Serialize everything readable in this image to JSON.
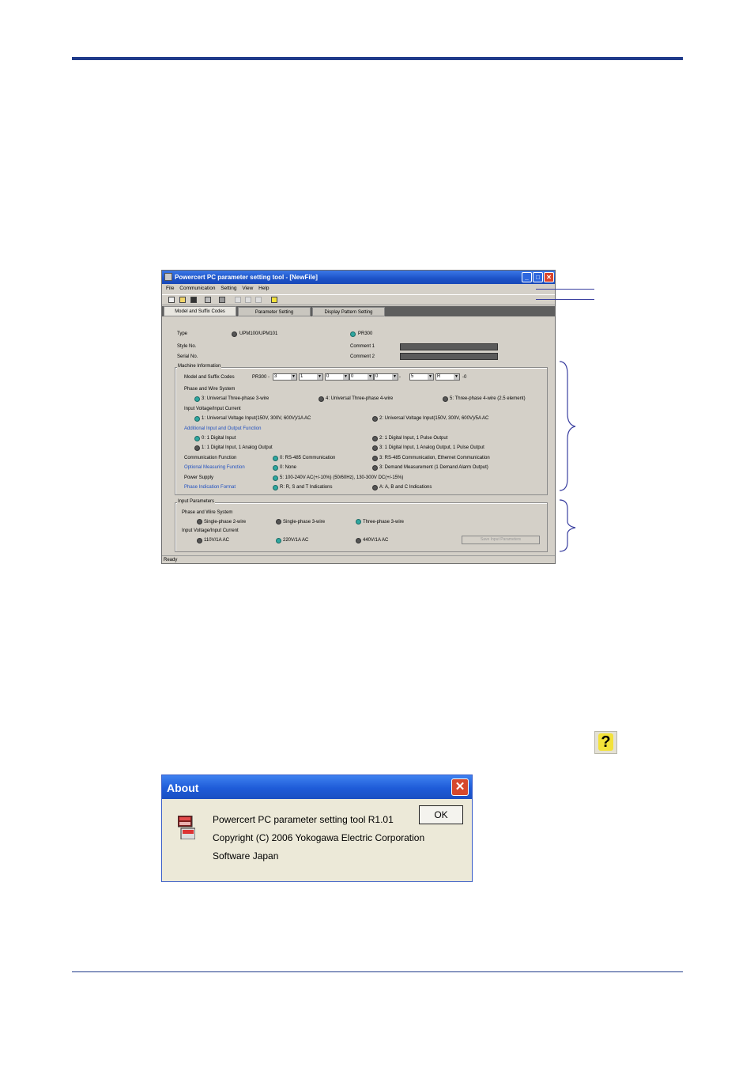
{
  "window": {
    "title": "Powercert PC parameter setting tool - [NewFile]",
    "menu": [
      "File",
      "Communication",
      "Setting",
      "View",
      "Help"
    ],
    "tabs": [
      "Model and Suffix Codes",
      "Parameter Setting",
      "Display Pattern Setting"
    ],
    "type_label": "Type",
    "type_opt1": "UPM100/UPM101",
    "type_opt2": "PR300",
    "style_no": "Style No.",
    "serial_no": "Serial No.",
    "comment1": "Comment 1",
    "comment2": "Comment 2",
    "machine_info": "Machine Information",
    "model_suffix": "Model and Suffix Codes",
    "model_prefix": "PR300 -",
    "codes": [
      "3",
      "1",
      "0",
      "0",
      "0",
      "5",
      "R"
    ],
    "code_dash": "-",
    "code_suffix": "-0",
    "phase_wire": "Phase and Wire System",
    "pw_opt1": "3: Universal Three-phase 3-wire",
    "pw_opt2": "4: Universal Three-phase 4-wire",
    "pw_opt3": "5: Three-phase 4-wire (2.5 element)",
    "input_vc": "Input Voltage/Input Current",
    "ivc_opt1": "1: Universal Voltage Input(150V, 300V, 600V)/1A AC",
    "ivc_opt2": "2: Universal Voltage Input(150V, 300V, 600V)/5A AC",
    "addl_io": "Additional Input and Output Function",
    "io_opt0": "0: 1 Digital Input",
    "io_opt1": "1: 1 Digital Input, 1 Analog Output",
    "io_opt2": "2: 1 Digital Input, 1 Pulse Output",
    "io_opt3": "3: 1 Digital Input, 1 Analog Output, 1 Pulse Output",
    "comm_func": "Communication Function",
    "comm_opt0": "0: RS-485 Communication",
    "comm_opt3": "3: RS-485 Communication, Ethernet Communication",
    "opt_meas": "Optional Measuring Function",
    "meas_opt0": "0: None",
    "meas_opt3": "3: Demand Measurement (1 Demand Alarm Output)",
    "power_supply": "Power Supply",
    "ps_opt": "5: 100-240V AC(+/-10%) (50/60Hz), 130-300V DC(+/-15%)",
    "phase_ind": "Phase Indication Format",
    "pi_opt_r": "R: R, S and T Indications",
    "pi_opt_a": "A: A, B and C Indications",
    "input_params": "Input Parameters",
    "ip_phase_wire": "Phase and Wire System",
    "ip_pw1": "Single-phase 2-wire",
    "ip_pw2": "Single-phase 3-wire",
    "ip_pw3": "Three-phase 3-wire",
    "ip_vc": "Input Voltage/Input Current",
    "ip_vc1": "110V/1A AC",
    "ip_vc2": "220V/1A AC",
    "ip_vc3": "440V/1A AC",
    "disabled_btn": "Save Input Parameters",
    "status": "Ready"
  },
  "about": {
    "title": "About",
    "line1": "Powercert PC parameter setting tool  R1.01",
    "line2": "Copyright (C) 2006 Yokogawa Electric Corporation",
    "line3": "Software Japan",
    "ok": "OK"
  },
  "help_icon": "?"
}
